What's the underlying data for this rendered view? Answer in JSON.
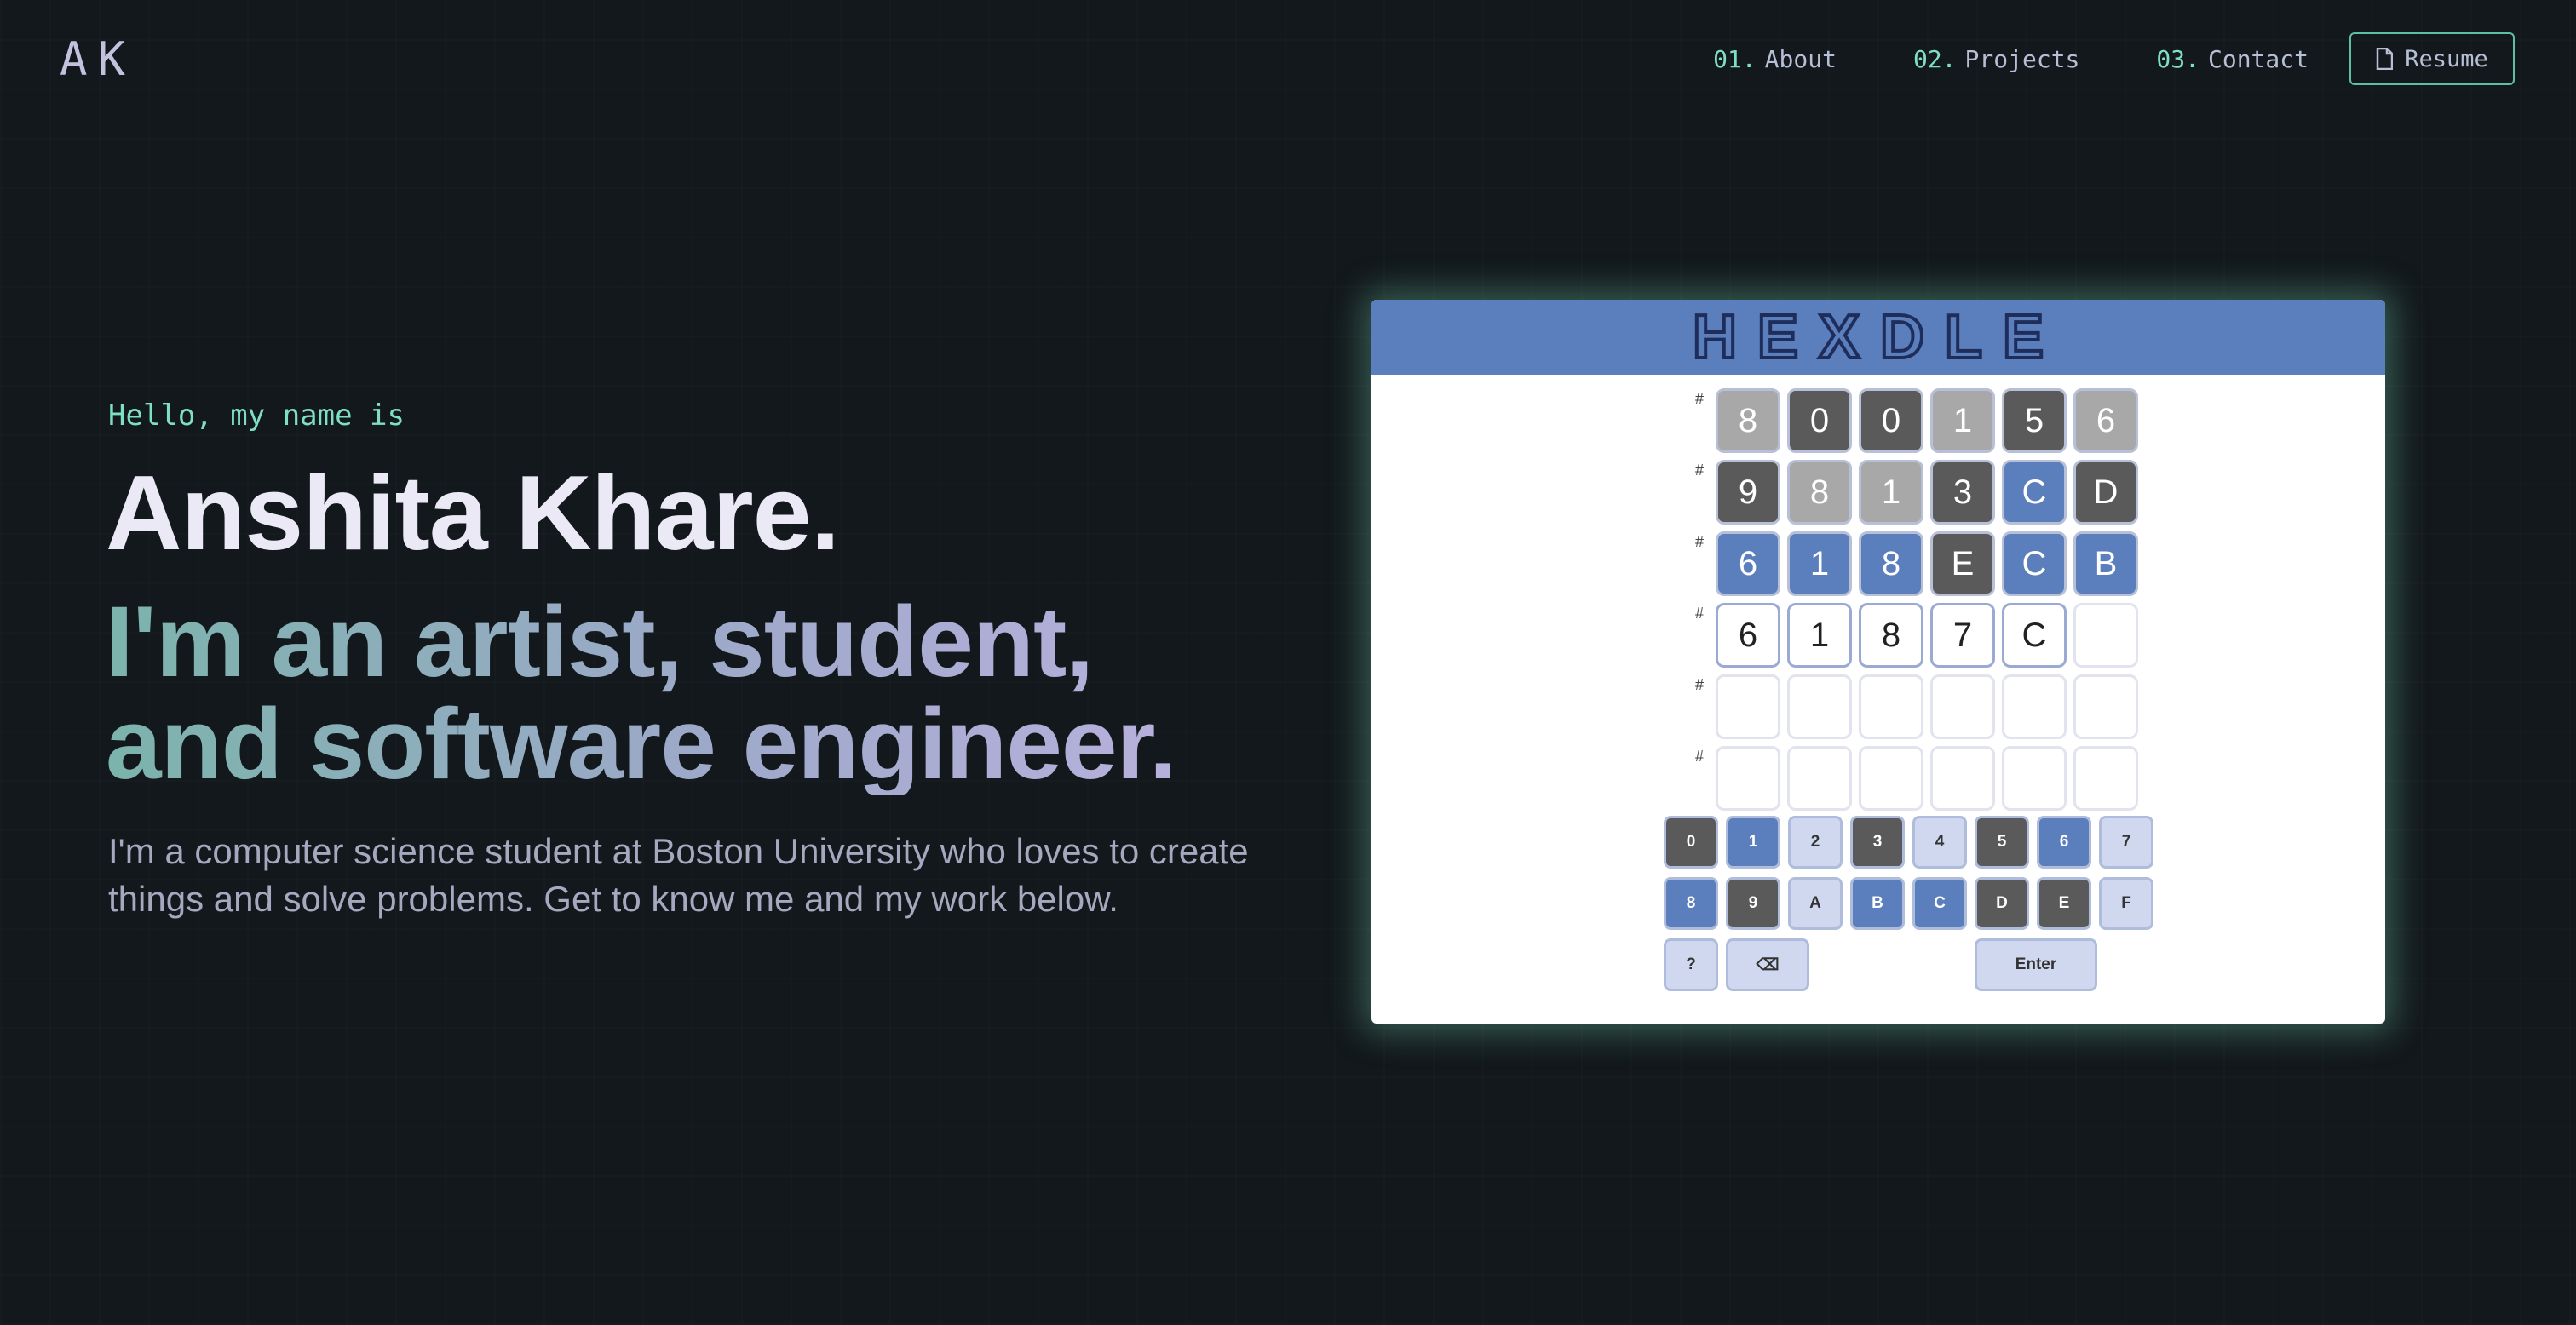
{
  "logo": "AK",
  "nav": {
    "items": [
      {
        "num": "01.",
        "label": "About"
      },
      {
        "num": "02.",
        "label": "Projects"
      },
      {
        "num": "03.",
        "label": "Contact"
      }
    ],
    "resume_label": "Resume"
  },
  "hero": {
    "greeting": "Hello, my name is",
    "name": "Anshita Khare.",
    "tagline_line1": "I'm an artist, student,",
    "tagline_line2": "and software engineer.",
    "description": "I'm a computer science student at Boston University who loves to create things and solve problems. Get to know me and my work below."
  },
  "hexdle": {
    "title": "HEXDLE",
    "hash": "#",
    "rows": [
      [
        {
          "v": "8",
          "s": "gray"
        },
        {
          "v": "0",
          "s": "dark"
        },
        {
          "v": "0",
          "s": "dark"
        },
        {
          "v": "1",
          "s": "gray"
        },
        {
          "v": "5",
          "s": "dark"
        },
        {
          "v": "6",
          "s": "gray"
        }
      ],
      [
        {
          "v": "9",
          "s": "dark"
        },
        {
          "v": "8",
          "s": "gray"
        },
        {
          "v": "1",
          "s": "gray"
        },
        {
          "v": "3",
          "s": "dark"
        },
        {
          "v": "C",
          "s": "blue"
        },
        {
          "v": "D",
          "s": "dark"
        }
      ],
      [
        {
          "v": "6",
          "s": "blue"
        },
        {
          "v": "1",
          "s": "blue"
        },
        {
          "v": "8",
          "s": "blue"
        },
        {
          "v": "E",
          "s": "dark"
        },
        {
          "v": "C",
          "s": "blue"
        },
        {
          "v": "B",
          "s": "blue"
        }
      ],
      [
        {
          "v": "6",
          "s": "white"
        },
        {
          "v": "1",
          "s": "white"
        },
        {
          "v": "8",
          "s": "white"
        },
        {
          "v": "7",
          "s": "white"
        },
        {
          "v": "C",
          "s": "white"
        },
        {
          "v": "",
          "s": "empty"
        }
      ],
      [
        {
          "v": "",
          "s": "empty"
        },
        {
          "v": "",
          "s": "empty"
        },
        {
          "v": "",
          "s": "empty"
        },
        {
          "v": "",
          "s": "empty"
        },
        {
          "v": "",
          "s": "empty"
        },
        {
          "v": "",
          "s": "empty"
        }
      ],
      [
        {
          "v": "",
          "s": "empty"
        },
        {
          "v": "",
          "s": "empty"
        },
        {
          "v": "",
          "s": "empty"
        },
        {
          "v": "",
          "s": "empty"
        },
        {
          "v": "",
          "s": "empty"
        },
        {
          "v": "",
          "s": "empty"
        }
      ]
    ],
    "keys_row1": [
      {
        "v": "0",
        "s": "dark"
      },
      {
        "v": "1",
        "s": "blue"
      },
      {
        "v": "2",
        "s": "light"
      },
      {
        "v": "3",
        "s": "dark"
      },
      {
        "v": "4",
        "s": "light"
      },
      {
        "v": "5",
        "s": "dark"
      },
      {
        "v": "6",
        "s": "blue"
      },
      {
        "v": "7",
        "s": "light"
      }
    ],
    "keys_row2": [
      {
        "v": "8",
        "s": "blue"
      },
      {
        "v": "9",
        "s": "dark"
      },
      {
        "v": "A",
        "s": "light"
      },
      {
        "v": "B",
        "s": "blue"
      },
      {
        "v": "C",
        "s": "blue"
      },
      {
        "v": "D",
        "s": "dark"
      },
      {
        "v": "E",
        "s": "dark"
      },
      {
        "v": "F",
        "s": "light"
      }
    ],
    "help_key": "?",
    "back_key": "⌫",
    "enter_key": "Enter"
  }
}
